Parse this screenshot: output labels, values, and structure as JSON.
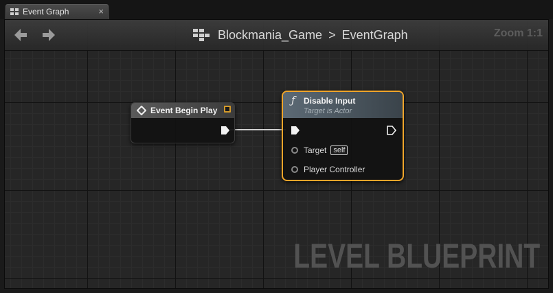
{
  "tab": {
    "label": "Event Graph",
    "close": "×"
  },
  "toolbar": {
    "breadcrumb": {
      "root": "Blockmania_Game",
      "separator": ">",
      "current": "EventGraph"
    },
    "zoom": "Zoom 1:1"
  },
  "watermark": "LEVEL BLUEPRINT",
  "nodes": {
    "event_begin_play": {
      "title": "Event Begin Play"
    },
    "disable_input": {
      "icon": "ƒ",
      "title": "Disable Input",
      "subtitle": "Target is Actor",
      "pins": {
        "target_label": "Target",
        "target_default": "self",
        "player_controller_label": "Player Controller"
      }
    }
  },
  "colors": {
    "selection_outline": "#f0a52a",
    "delegate_pin": "#d49a2a",
    "wire": "#d0d0d0"
  },
  "icons": {
    "back": "back-arrow-icon",
    "forward": "forward-arrow-icon",
    "blueprint": "blueprint-graph-icon",
    "event": "event-diamond-icon",
    "function": "function-icon"
  }
}
